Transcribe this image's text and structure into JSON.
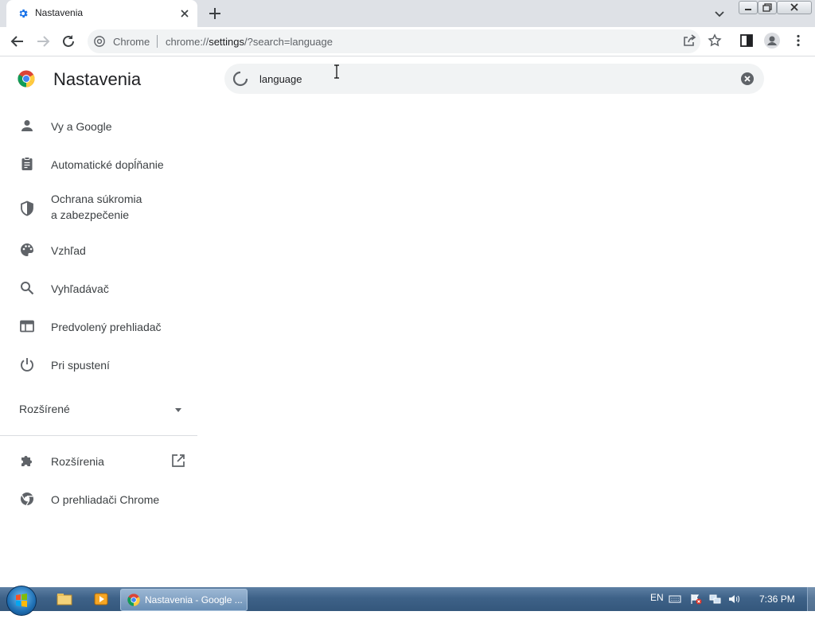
{
  "browser": {
    "tab": {
      "title": "Nastavenia"
    },
    "omnibox": {
      "site_chip": "Chrome",
      "url_host": "chrome://",
      "url_path": "settings",
      "url_query": "/?search=language"
    }
  },
  "settings": {
    "title": "Nastavenia",
    "search": {
      "value": "language"
    },
    "nav": [
      {
        "label": "Vy a Google",
        "icon": "person-icon"
      },
      {
        "label": "Automatické dopĺňanie",
        "icon": "clipboard-icon"
      },
      {
        "label": "Ochrana súkromia\na zabezpečenie",
        "icon": "shield-icon"
      },
      {
        "label": "Vzhľad",
        "icon": "palette-icon"
      },
      {
        "label": "Vyhľadávač",
        "icon": "search-icon"
      },
      {
        "label": "Predvolený prehliadač",
        "icon": "browser-icon"
      },
      {
        "label": "Pri spustení",
        "icon": "power-icon"
      }
    ],
    "advanced": {
      "label": "Rozšírené"
    },
    "extensions": {
      "label": "Rozšírenia"
    },
    "about": {
      "label": "O prehliadači Chrome"
    }
  },
  "taskbar": {
    "task_label": "Nastavenia - Google ...",
    "language": "EN",
    "clock": "7:36 PM"
  },
  "colors": {
    "accent": "#1a73e8",
    "icon_gray": "#5f6368",
    "text": "#202124"
  }
}
